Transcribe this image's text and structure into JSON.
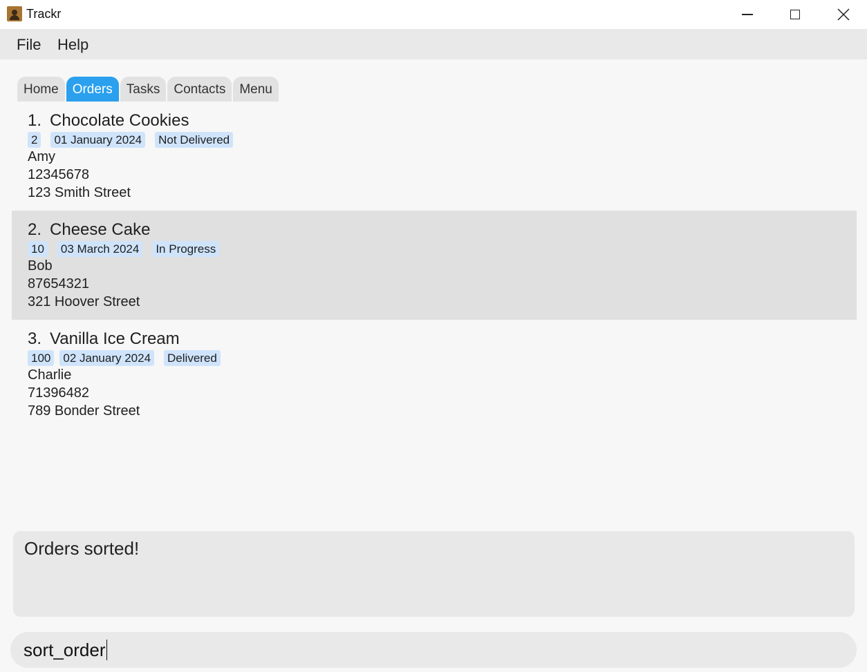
{
  "window": {
    "title": "Trackr"
  },
  "menu": {
    "file": "File",
    "help": "Help"
  },
  "tabs": [
    {
      "label": "Home",
      "active": false
    },
    {
      "label": "Orders",
      "active": true
    },
    {
      "label": "Tasks",
      "active": false
    },
    {
      "label": "Contacts",
      "active": false
    },
    {
      "label": "Menu",
      "active": false
    }
  ],
  "orders": [
    {
      "index": "1.",
      "name": "Chocolate Cookies",
      "quantity": "2",
      "date": "01 January 2024",
      "status": "Not Delivered",
      "customer": "Amy",
      "phone": "12345678",
      "address": "123 Smith Street",
      "selected": false
    },
    {
      "index": "2.",
      "name": "Cheese Cake",
      "quantity": "10",
      "date": "03 March 2024",
      "status": "In Progress",
      "customer": "Bob",
      "phone": "87654321",
      "address": "321 Hoover Street",
      "selected": true
    },
    {
      "index": "3.",
      "name": "Vanilla Ice Cream",
      "quantity": "100",
      "date": "02 January 2024",
      "status": "Delivered",
      "customer": "Charlie",
      "phone": "71396482",
      "address": "789 Bonder Street",
      "selected": false
    }
  ],
  "result": {
    "message": "Orders sorted!"
  },
  "command": {
    "value": "sort_order"
  },
  "colors": {
    "accent": "#2aa0ee",
    "tag": "#cfe4fb",
    "selected_row": "#e0e0e0"
  }
}
